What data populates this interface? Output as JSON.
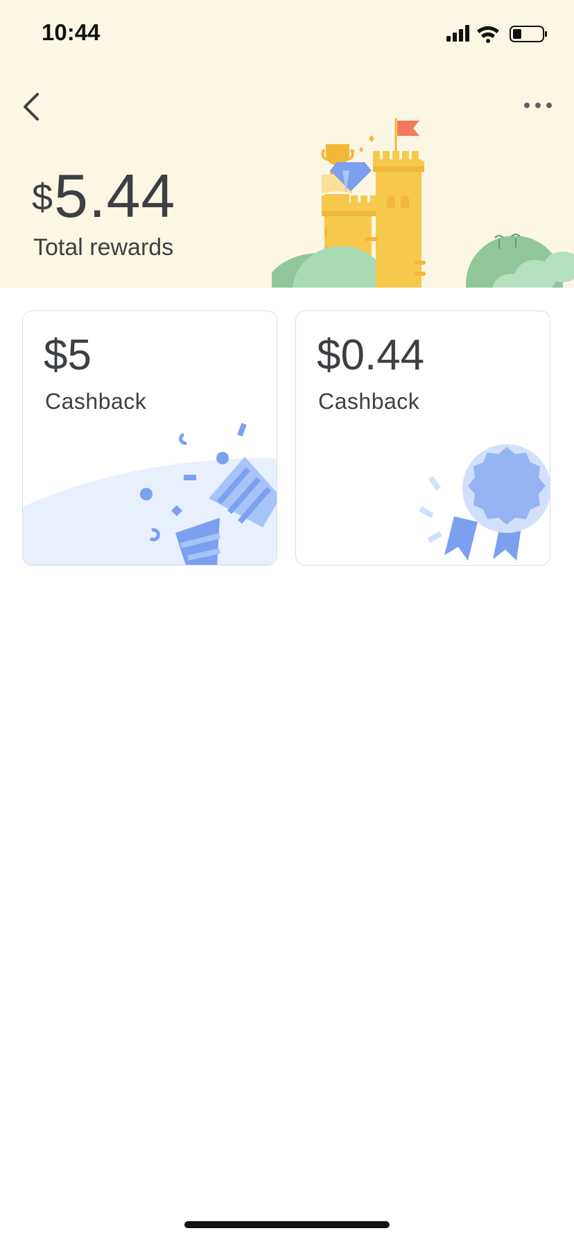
{
  "status_bar": {
    "time": "10:44"
  },
  "header": {
    "back_icon": "chevron-left-icon",
    "more_icon": "more-horizontal-icon",
    "currency_symbol": "$",
    "total_amount": "5.44",
    "total_label": "Total rewards"
  },
  "cards": [
    {
      "amount": "$5",
      "label": "Cashback",
      "art": "confetti-party-popper"
    },
    {
      "amount": "$0.44",
      "label": "Cashback",
      "art": "award-ribbon"
    }
  ],
  "colors": {
    "hero_bg": "#fcf6e4",
    "text": "#3c4043",
    "accent_blue": "#7ba0ef",
    "light_blue": "#e8f0fe"
  }
}
